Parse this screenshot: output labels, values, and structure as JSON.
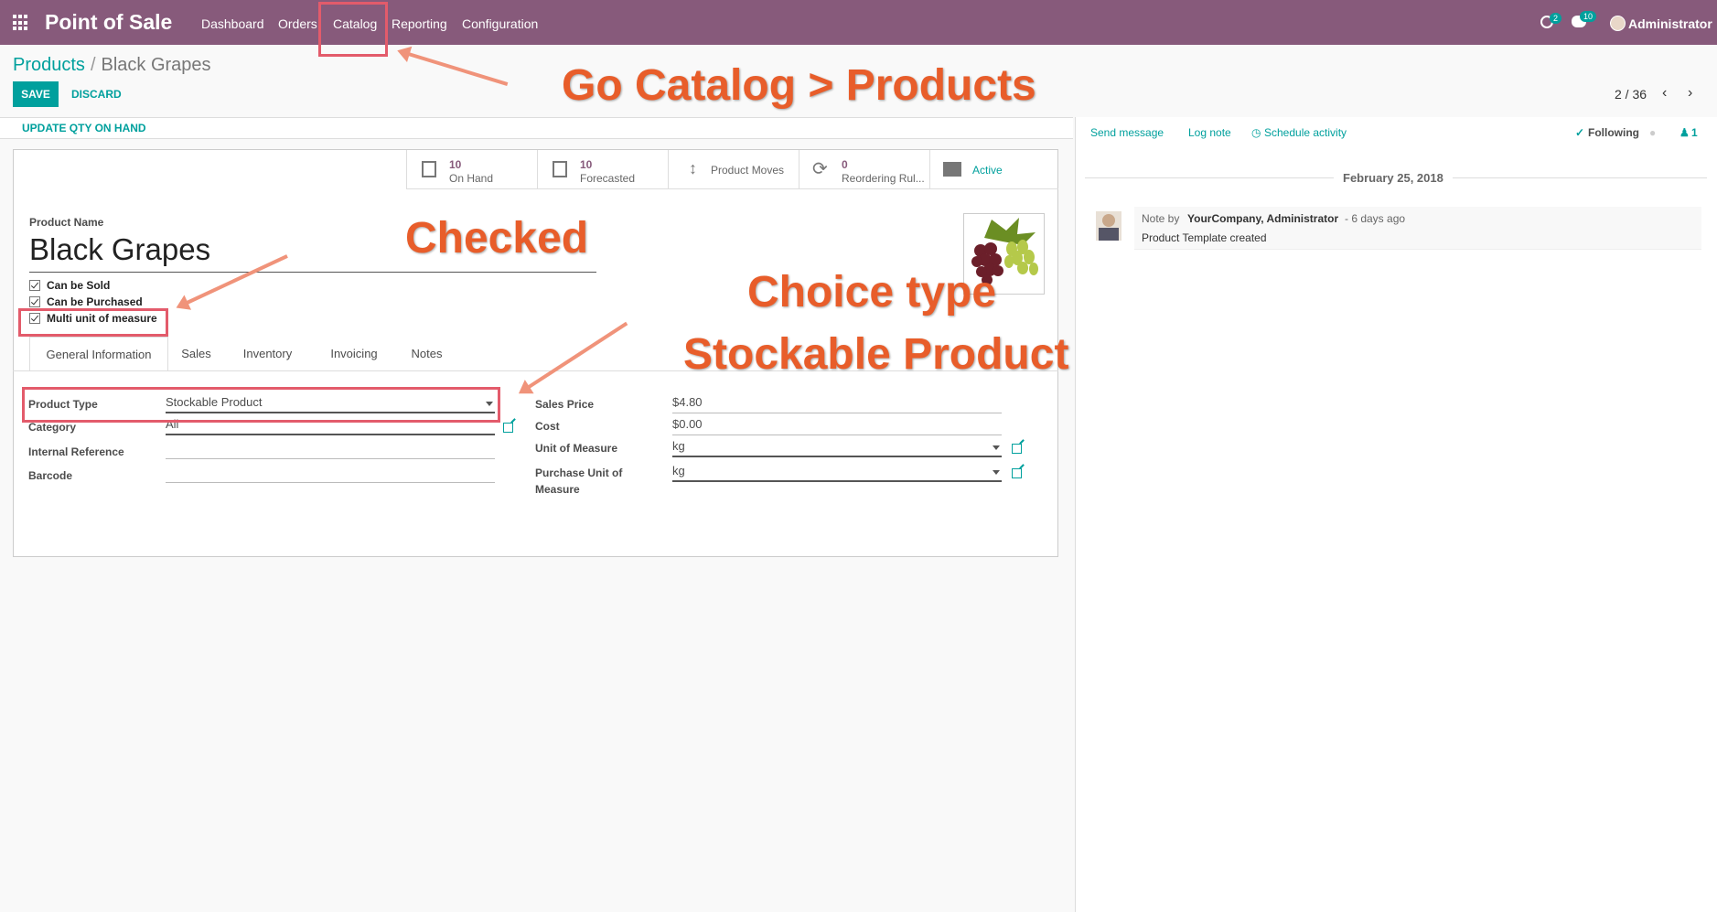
{
  "topbar": {
    "app_name": "Point of Sale",
    "menu": [
      "Dashboard",
      "Orders",
      "Catalog",
      "Reporting",
      "Configuration"
    ],
    "activity_badge": "2",
    "message_badge": "10",
    "user": "Administrator"
  },
  "breadcrumb": {
    "parent": "Products",
    "separator": "/",
    "current": "Black Grapes"
  },
  "buttons": {
    "save": "SAVE",
    "discard": "DISCARD",
    "update_qty": "UPDATE QTY ON HAND"
  },
  "pager": {
    "value": "2 / 36"
  },
  "smart_buttons": {
    "on_hand": {
      "value": "10",
      "label": "On Hand"
    },
    "forecasted": {
      "value": "10",
      "label": "Forecasted"
    },
    "moves": {
      "label": "Product Moves"
    },
    "reordering": {
      "value": "0",
      "label": "Reordering Rul..."
    },
    "active": {
      "label": "Active"
    }
  },
  "product": {
    "name_label": "Product Name",
    "name": "Black Grapes",
    "checkboxes": [
      "Can be Sold",
      "Can be Purchased",
      "Multi unit of measure"
    ]
  },
  "tabs": [
    "General Information",
    "Sales",
    "Inventory",
    "Invoicing",
    "Notes"
  ],
  "fields_left": [
    {
      "label": "Product Type",
      "value": "Stockable Product"
    },
    {
      "label": "Category",
      "value": "All"
    },
    {
      "label": "Internal Reference",
      "value": ""
    },
    {
      "label": "Barcode",
      "value": ""
    }
  ],
  "fields_right": [
    {
      "label": "Sales Price",
      "value": "$4.80"
    },
    {
      "label": "Cost",
      "value": "$0.00"
    },
    {
      "label": "Unit of Measure",
      "value": "kg"
    },
    {
      "label": "Purchase Unit of",
      "label2": "Measure",
      "value": "kg"
    }
  ],
  "chatter": {
    "send_message": "Send message",
    "log_note": "Log note",
    "schedule": "Schedule activity",
    "following": "Following",
    "followers": "1",
    "date": "February 25, 2018",
    "note_prefix": "Note by",
    "author": "YourCompany, Administrator",
    "when": "- 6 days ago",
    "body": "Product Template created"
  },
  "annotations": {
    "catalog": "Go Catalog > Products",
    "checked": "Checked",
    "choice1": "Choice type",
    "choice2": "Stockable Product"
  },
  "colors": {
    "brand": "#875a7b",
    "accent": "#00a09d",
    "annotation": "#e85d2a",
    "highlight_box": "#e35b6b"
  }
}
